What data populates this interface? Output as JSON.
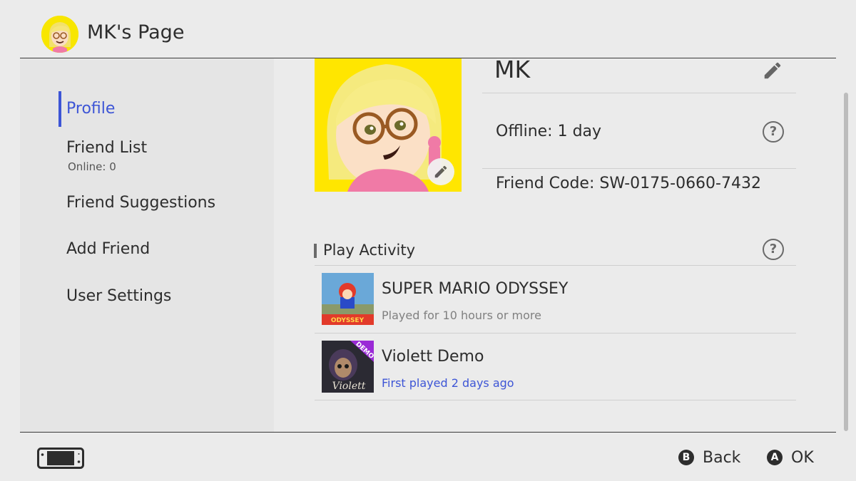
{
  "header": {
    "title": "MK's Page"
  },
  "sidebar": {
    "items": [
      {
        "label": "Profile"
      },
      {
        "label": "Friend List",
        "sub": "Online: 0"
      },
      {
        "label": "Friend Suggestions"
      },
      {
        "label": "Add Friend"
      },
      {
        "label": "User Settings"
      }
    ]
  },
  "profile": {
    "name": "MK",
    "offline": "Offline: 1 day",
    "friend_code": "Friend Code: SW-0175-0660-7432"
  },
  "play_activity": {
    "title": "Play Activity",
    "games": [
      {
        "title": "SUPER MARIO ODYSSEY",
        "detail": "Played for 10 hours or more",
        "thumb_text": "ODYSSEY"
      },
      {
        "title": "Violett Demo",
        "detail": "First played 2 days ago",
        "thumb_text": "Violett",
        "badge": "DEMO"
      }
    ]
  },
  "footer": {
    "back_key": "B",
    "back_label": "Back",
    "ok_key": "A",
    "ok_label": "OK"
  },
  "colors": {
    "accent": "#3d55d6",
    "background": "#ebebeb",
    "avatar_bg": "#ffe600"
  }
}
